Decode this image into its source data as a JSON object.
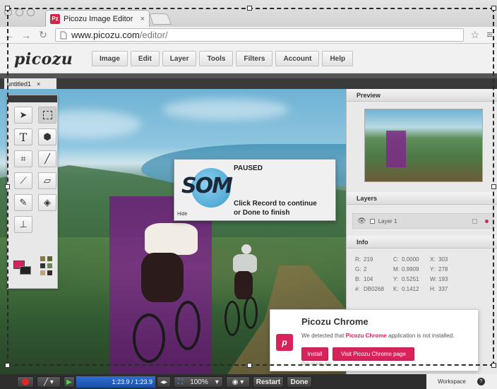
{
  "browser": {
    "tab_title": "Picozu Image Editor",
    "tab_favicon": "Pz",
    "tab_close": "×",
    "url_host": "www.picozu.com",
    "url_path": "/editor/"
  },
  "app": {
    "logo": "picozu",
    "menu": [
      "Image",
      "Edit",
      "Layer",
      "Tools",
      "Filters",
      "Account",
      "Help"
    ],
    "document_tab": "untitled1",
    "document_tab_close": "×"
  },
  "panels": {
    "preview_title": "Preview",
    "layers_title": "Layers",
    "layer_name": "Layer 1",
    "info_title": "Info",
    "info": [
      [
        "R:",
        "219",
        "C:",
        "0.0000",
        "X:",
        "303"
      ],
      [
        "G:",
        "2",
        "M:",
        "0.9909",
        "Y:",
        "278"
      ],
      [
        "B:",
        "104",
        "Y:",
        "0.5251",
        "W:",
        "193"
      ],
      [
        "#:",
        "DB0268",
        "K:",
        "0.1412",
        "H:",
        "337"
      ]
    ]
  },
  "dialog": {
    "logo": "SOM",
    "status": "PAUSED",
    "message_line1": "Click Record to continue",
    "message_line2": "or Done to finish",
    "hide": "Hide"
  },
  "notification": {
    "icon_letter": "p",
    "title": "Picozu Chrome",
    "msg_before": "We detected that ",
    "msg_app": "Picozu Chrome",
    "msg_after": " application is not installed.",
    "install": "Install",
    "visit": "Visit Picozu Chrome page",
    "time": "One minute ago"
  },
  "recorder": {
    "time": "1:23.9 / 1:23.9",
    "zoom": "100%",
    "restart": "Restart",
    "done": "Done",
    "workspace": "Workspace"
  },
  "colors": {
    "accent": "#d8235a",
    "selection": "#7c2a88"
  }
}
